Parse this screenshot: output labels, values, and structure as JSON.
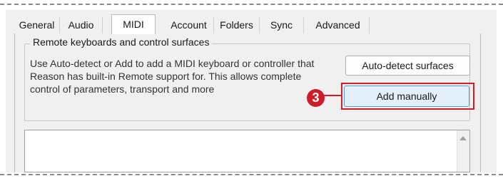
{
  "tabs": [
    {
      "label": "General"
    },
    {
      "label": "Audio"
    },
    {
      "label": "MIDI"
    },
    {
      "label": "Account"
    },
    {
      "label": "Folders"
    },
    {
      "label": "Sync"
    },
    {
      "label": "Advanced"
    }
  ],
  "active_tab": "MIDI",
  "group": {
    "title": "Remote keyboards and control surfaces",
    "description": "Use Auto-detect or Add to add a MIDI keyboard or controller that Reason has built-in Remote support for. This allows complete control of parameters, transport and more",
    "auto_detect_label": "Auto-detect surfaces",
    "add_manually_label": "Add manually"
  },
  "callout": {
    "number": "3",
    "color": "#d01c28"
  },
  "colors": {
    "window_bg": "#f0f0f0",
    "highlight": "#d01c28",
    "selected_button": "#e3effa"
  }
}
